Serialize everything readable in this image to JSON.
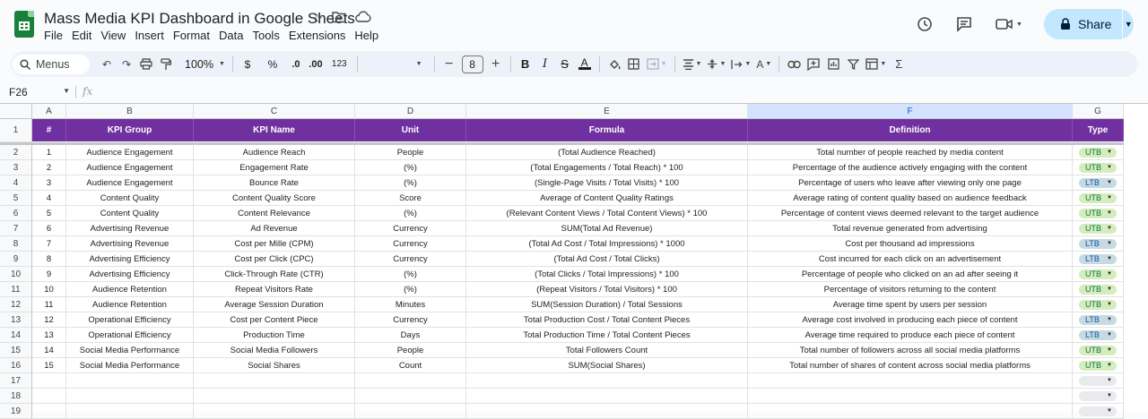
{
  "doc": {
    "title": "Mass Media KPI Dashboard in Google Sheets",
    "menu": [
      "File",
      "Edit",
      "View",
      "Insert",
      "Format",
      "Data",
      "Tools",
      "Extensions",
      "Help"
    ],
    "share_label": "Share"
  },
  "toolbar": {
    "search_label": "Menus",
    "zoom": "100%",
    "currency": "$",
    "percent": "%",
    "dec_decrease": ".0",
    "dec_increase": ".00",
    "number_format": "123",
    "font_size": "8"
  },
  "formula_bar": {
    "cell_ref": "F26",
    "fx": "fx",
    "content": ""
  },
  "sheet": {
    "column_letters": [
      "A",
      "B",
      "C",
      "D",
      "E",
      "F",
      "G"
    ],
    "headers": [
      "#",
      "KPI Group",
      "KPI Name",
      "Unit",
      "Formula",
      "Definition",
      "Type"
    ],
    "row_numbers": [
      "1",
      "2",
      "3",
      "4",
      "5",
      "6",
      "7",
      "8",
      "9",
      "10",
      "11",
      "12",
      "13",
      "14",
      "15",
      "16",
      "17",
      "18",
      "19"
    ],
    "rows": [
      [
        "1",
        "Audience Engagement",
        "Audience Reach",
        "People",
        "(Total Audience Reached)",
        "Total number of people reached by media content",
        "UTB"
      ],
      [
        "2",
        "Audience Engagement",
        "Engagement Rate",
        "(%)",
        "(Total Engagements / Total Reach) * 100",
        "Percentage of the audience actively engaging with the content",
        "UTB"
      ],
      [
        "3",
        "Audience Engagement",
        "Bounce Rate",
        "(%)",
        "(Single-Page Visits / Total Visits) * 100",
        "Percentage of users who leave after viewing only one page",
        "LTB"
      ],
      [
        "4",
        "Content Quality",
        "Content Quality Score",
        "Score",
        "Average of Content Quality Ratings",
        "Average rating of content quality based on audience feedback",
        "UTB"
      ],
      [
        "5",
        "Content Quality",
        "Content Relevance",
        "(%)",
        "(Relevant Content Views / Total Content Views) * 100",
        "Percentage of content views deemed relevant to the target audience",
        "UTB"
      ],
      [
        "6",
        "Advertising Revenue",
        "Ad Revenue",
        "Currency",
        "SUM(Total Ad Revenue)",
        "Total revenue generated from advertising",
        "UTB"
      ],
      [
        "7",
        "Advertising Revenue",
        "Cost per Mille (CPM)",
        "Currency",
        "(Total Ad Cost / Total Impressions) * 1000",
        "Cost per thousand ad impressions",
        "LTB"
      ],
      [
        "8",
        "Advertising Efficiency",
        "Cost per Click (CPC)",
        "Currency",
        "(Total Ad Cost / Total Clicks)",
        "Cost incurred for each click on an advertisement",
        "LTB"
      ],
      [
        "9",
        "Advertising Efficiency",
        "Click-Through Rate (CTR)",
        "(%)",
        "(Total Clicks / Total Impressions) * 100",
        "Percentage of people who clicked on an ad after seeing it",
        "UTB"
      ],
      [
        "10",
        "Audience Retention",
        "Repeat Visitors Rate",
        "(%)",
        "(Repeat Visitors / Total Visitors) * 100",
        "Percentage of visitors returning to the content",
        "UTB"
      ],
      [
        "11",
        "Audience Retention",
        "Average Session Duration",
        "Minutes",
        "SUM(Session Duration) / Total Sessions",
        "Average time spent by users per session",
        "UTB"
      ],
      [
        "12",
        "Operational Efficiency",
        "Cost per Content Piece",
        "Currency",
        "Total Production Cost / Total Content Pieces",
        "Average cost involved in producing each piece of content",
        "LTB"
      ],
      [
        "13",
        "Operational Efficiency",
        "Production Time",
        "Days",
        "Total Production Time / Total Content Pieces",
        "Average time required to produce each piece of content",
        "LTB"
      ],
      [
        "14",
        "Social Media Performance",
        "Social Media Followers",
        "People",
        "Total Followers Count",
        "Total number of followers across all social media platforms",
        "UTB"
      ],
      [
        "15",
        "Social Media Performance",
        "Social Shares",
        "Count",
        "SUM(Social Shares)",
        "Total number of shares of content across social media platforms",
        "UTB"
      ],
      [
        "",
        "",
        "",
        "",
        "",
        "",
        ""
      ],
      [
        "",
        "",
        "",
        "",
        "",
        "",
        ""
      ],
      [
        "",
        "",
        "",
        "",
        "",
        "",
        ""
      ]
    ]
  },
  "colors": {
    "header_purple": "#7030a0",
    "utb_chip": "#d4edbc",
    "ltb_chip": "#c6dbe1",
    "share_button": "#c2e7ff",
    "selected_column": "#d3e3fd"
  }
}
